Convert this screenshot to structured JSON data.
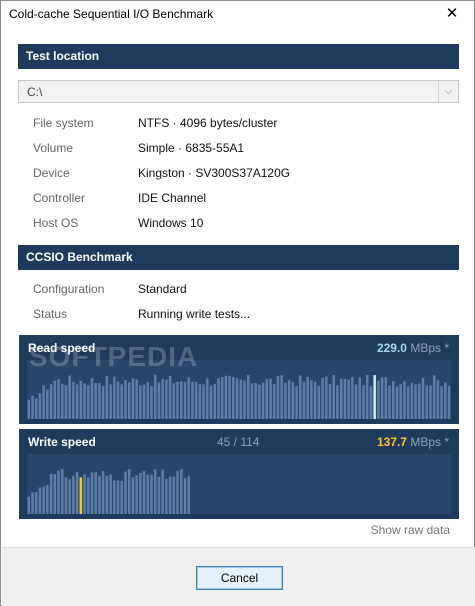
{
  "window": {
    "title": "Cold-cache Sequential I/O Benchmark",
    "close_glyph": "✕"
  },
  "test_location": {
    "header": "Test location",
    "drive_value": "C:\\",
    "rows": [
      {
        "label": "File system",
        "value": "NTFS  ·  4096 bytes/cluster"
      },
      {
        "label": "Volume",
        "value": "Simple  ·  6835-55A1"
      },
      {
        "label": "Device",
        "value": "Kingston  ·  SV300S37A120G"
      },
      {
        "label": "Controller",
        "value": "IDE Channel"
      },
      {
        "label": "Host OS",
        "value": "Windows 10"
      }
    ]
  },
  "benchmark": {
    "header": "CCSIO Benchmark",
    "rows": [
      {
        "label": "Configuration",
        "value": "Standard"
      },
      {
        "label": "Status",
        "value": "Running write tests..."
      }
    ]
  },
  "read_graph": {
    "title": "Read speed",
    "value": "229.0",
    "unit": " MBps *",
    "value_color": "#a8d8f0",
    "marker_fraction": 0.82
  },
  "write_graph": {
    "title": "Write speed",
    "progress": "45 / 114",
    "value": "137.7",
    "unit": " MBps *",
    "value_color": "#ffc52a",
    "marker_fraction": 0.12,
    "filled_fraction": 0.39
  },
  "watermark": "SOFTPEDIA",
  "raw_link": "Show raw data",
  "footer": {
    "cancel_label": "Cancel"
  }
}
